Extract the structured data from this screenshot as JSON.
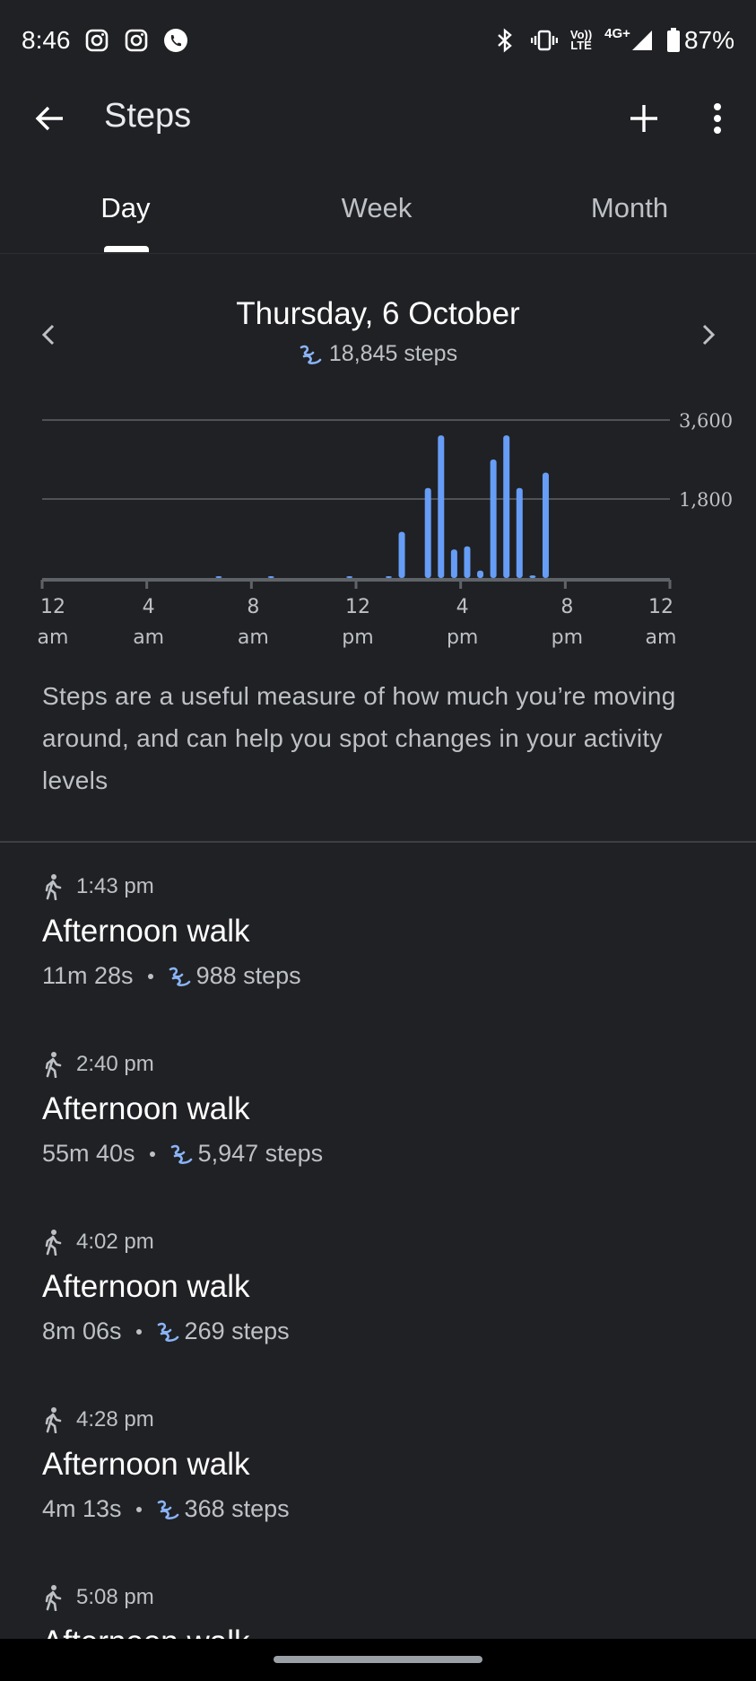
{
  "status_bar": {
    "time": "8:46",
    "battery": "87%",
    "volte_line1": "Vo))",
    "volte_line2": "LTE",
    "network": "4G+",
    "icons": [
      "instagram-icon",
      "instagram-icon",
      "whatsapp-icon",
      "bluetooth-icon",
      "vibrate-icon",
      "signal-icon",
      "battery-icon"
    ]
  },
  "app_bar": {
    "title": "Steps",
    "icons": [
      "back-arrow-icon",
      "add-icon",
      "more-vert-icon"
    ]
  },
  "tabs": [
    {
      "label": "Day",
      "active": true
    },
    {
      "label": "Week",
      "active": false
    },
    {
      "label": "Month",
      "active": false
    }
  ],
  "day_header": {
    "date": "Thursday, 6 October",
    "total_steps": "18,845 steps"
  },
  "chart_data": {
    "type": "bar",
    "color": "#669df6",
    "y_ticks": [
      "3,600",
      "1,800"
    ],
    "ylim": [
      0,
      3600
    ],
    "x_tick_labels": [
      {
        "top": "12",
        "bottom": "am"
      },
      {
        "top": "4",
        "bottom": "am"
      },
      {
        "top": "8",
        "bottom": "am"
      },
      {
        "top": "12",
        "bottom": "pm"
      },
      {
        "top": "4",
        "bottom": "pm"
      },
      {
        "top": "8",
        "bottom": "pm"
      },
      {
        "top": "12",
        "bottom": "am"
      }
    ],
    "xlim_hours": [
      0,
      24
    ],
    "bars": [
      {
        "hour": 6.75,
        "value": 15
      },
      {
        "hour": 8.75,
        "value": 15
      },
      {
        "hour": 11.75,
        "value": 20
      },
      {
        "hour": 13.25,
        "value": 40
      },
      {
        "hour": 13.75,
        "value": 1050
      },
      {
        "hour": 14.75,
        "value": 2050
      },
      {
        "hour": 15.25,
        "value": 3250
      },
      {
        "hour": 15.75,
        "value": 650
      },
      {
        "hour": 16.25,
        "value": 720
      },
      {
        "hour": 16.75,
        "value": 170
      },
      {
        "hour": 17.25,
        "value": 2700
      },
      {
        "hour": 17.75,
        "value": 3250
      },
      {
        "hour": 18.25,
        "value": 2050
      },
      {
        "hour": 18.75,
        "value": 60
      },
      {
        "hour": 19.25,
        "value": 2400
      }
    ]
  },
  "description": "Steps are a useful measure of how much you’re moving around, and can help you spot changes in your activity levels",
  "sessions": [
    {
      "time": "1:43 pm",
      "name": "Afternoon walk",
      "duration": "11m 28s",
      "steps": "988 steps"
    },
    {
      "time": "2:40 pm",
      "name": "Afternoon walk",
      "duration": "55m 40s",
      "steps": "5,947 steps"
    },
    {
      "time": "4:02 pm",
      "name": "Afternoon walk",
      "duration": "8m 06s",
      "steps": "269 steps"
    },
    {
      "time": "4:28 pm",
      "name": "Afternoon walk",
      "duration": "4m 13s",
      "steps": "368 steps"
    },
    {
      "time": "5:08 pm",
      "name": "Afternoon walk",
      "duration": "",
      "steps": ""
    }
  ]
}
